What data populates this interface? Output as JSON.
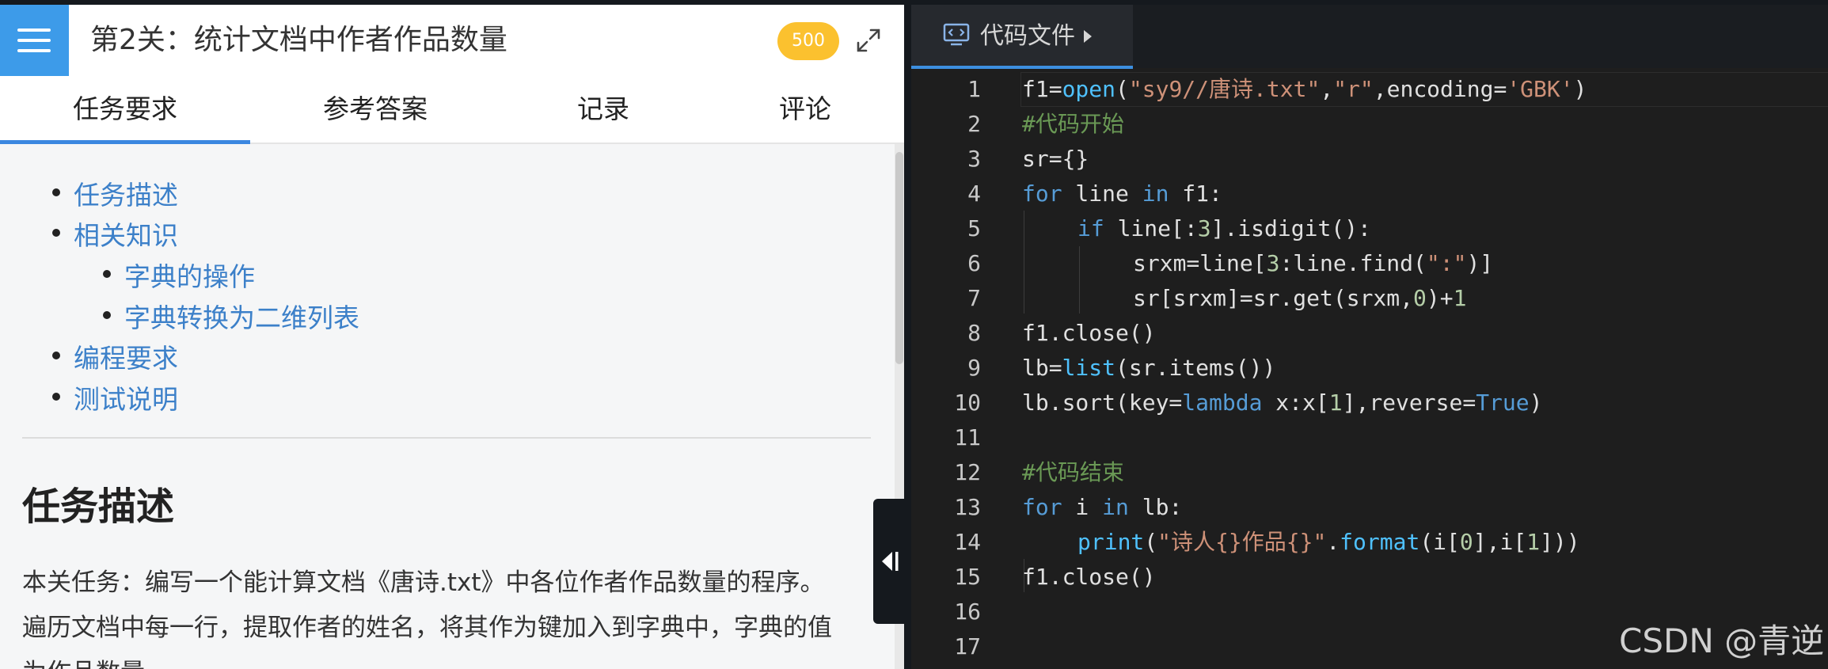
{
  "header": {
    "title": "第2关：统计文档中作者作品数量",
    "score_badge": "500"
  },
  "tabs": [
    "任务要求",
    "参考答案",
    "记录",
    "评论"
  ],
  "toc": [
    {
      "label": "任务描述",
      "level": 1
    },
    {
      "label": "相关知识",
      "level": 1
    },
    {
      "label": "字典的操作",
      "level": 2
    },
    {
      "label": "字典转换为二维列表",
      "level": 2
    },
    {
      "label": "编程要求",
      "level": 1
    },
    {
      "label": "测试说明",
      "level": 1
    }
  ],
  "section": {
    "heading": "任务描述",
    "para_line1": "本关任务：编写一个能计算文档《唐诗.txt》中各位作者作品数量的程序。",
    "para_line2": "遍历文档中每一行，提取作者的姓名，将其作为键加入到字典中，字典的值",
    "para_line3": "为作品数量。"
  },
  "editor": {
    "tab_label": "代码文件",
    "line_numbers": [
      "1",
      "2",
      "3",
      "4",
      "5",
      "6",
      "7",
      "8",
      "9",
      "10",
      "11",
      "12",
      "13",
      "14",
      "15",
      "16",
      "17"
    ]
  },
  "code": {
    "l1_a": "f1=",
    "l1_b": "open",
    "l1_c": "(",
    "l1_d": "\"sy9//唐诗.txt\"",
    "l1_e": ",",
    "l1_f": "\"r\"",
    "l1_g": ",encoding=",
    "l1_h": "'GBK'",
    "l1_i": ")",
    "l2": "#代码开始",
    "l3": "sr={}",
    "l4_a": "for",
    "l4_b": " line ",
    "l4_c": "in",
    "l4_d": " f1:",
    "l5_a": "if",
    "l5_b": " line[:",
    "l5_c": "3",
    "l5_d": "].isdigit():",
    "l6_a": "srxm=line[",
    "l6_b": "3",
    "l6_c": ":line.find(",
    "l6_d": "\":\"",
    "l6_e": ")]",
    "l7_a": "sr[srxm]=sr.get(srxm,",
    "l7_b": "0",
    "l7_c": ")+",
    "l7_d": "1",
    "l8": "f1.close()",
    "l9_a": "lb=",
    "l9_b": "list",
    "l9_c": "(sr.items())",
    "l10_a": "lb.sort(key=",
    "l10_b": "lambda",
    "l10_c": " x:x[",
    "l10_d": "1",
    "l10_e": "],reverse=",
    "l10_f": "True",
    "l10_g": ")",
    "l12": "#代码结束",
    "l13_a": "for",
    "l13_b": " i ",
    "l13_c": "in",
    "l13_d": " lb:",
    "l14_a": "print",
    "l14_b": "(",
    "l14_c": "\"诗人{}作品{}\"",
    "l14_d": ".",
    "l14_e": "format",
    "l14_f": "(i[",
    "l14_g": "0",
    "l14_h": "],i[",
    "l14_i": "1",
    "l14_j": "]))",
    "l15": "f1.close()"
  },
  "watermark": "CSDN @青逆",
  "colors": {
    "accent": "#3d9be9",
    "badge": "#fbc12f",
    "link": "#3c80c9"
  }
}
